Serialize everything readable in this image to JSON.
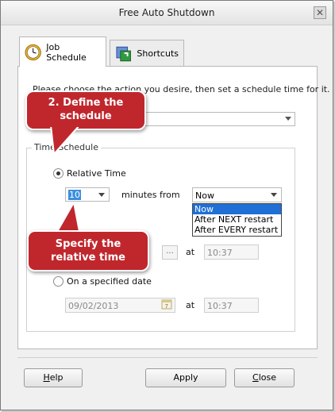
{
  "window": {
    "title": "Free Auto Shutdown"
  },
  "tabs": [
    {
      "label": "Job Schedule",
      "icon": "clock-icon",
      "active": true
    },
    {
      "label": "Shortcuts",
      "icon": "shortcut-icon",
      "active": false
    }
  ],
  "intro": {
    "text": "Please choose the action you desire, then set a schedule time for it."
  },
  "group": {
    "legend": "Time Schedule"
  },
  "relative": {
    "label": "Relative Time",
    "minutes_value": "10",
    "minutes_label": "minutes from",
    "from_selected": "Now",
    "from_options": [
      "Now",
      "After NEXT restart",
      "After EVERY restart"
    ]
  },
  "everyday": {
    "at_label": "at",
    "time": "10:37",
    "browse": "..."
  },
  "specified": {
    "label": "On a specified date",
    "date": "09/02/2013",
    "at_label": "at",
    "time": "10:37"
  },
  "callouts": {
    "define": [
      "2. Define the",
      "schedule"
    ],
    "specify": [
      "Specify the",
      "relative time"
    ]
  },
  "buttons": {
    "help_prefix": "H",
    "help_rest": "elp",
    "apply": "Apply",
    "close_prefix": "C",
    "close_rest": "lose"
  },
  "colors": {
    "callout": "#c0272d",
    "selection": "#1f6fd6"
  }
}
